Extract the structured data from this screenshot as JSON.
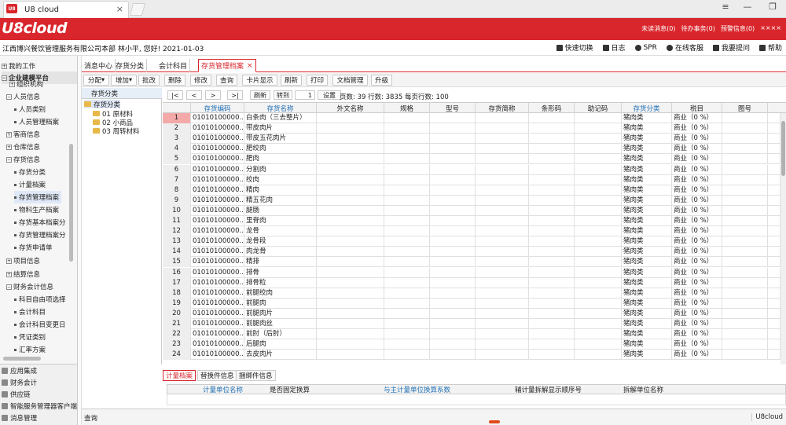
{
  "browser": {
    "tab_title": "U8 cloud",
    "tab_icon_text": "U8",
    "tab_close": "×",
    "win_menu": "≡",
    "win_min": "—",
    "win_restore": "❐"
  },
  "header": {
    "logo": "U8cloud",
    "links": [
      "未读消息(0)",
      "待办事务(0)",
      "预警信息(0)",
      "××××"
    ]
  },
  "infobar": {
    "company": "江西博兴餐饮管理服务有限公司本部 林小平, 您好! 2021-01-03",
    "links": [
      "快速切换",
      "日志",
      "SPR",
      "在线客服",
      "我要提问",
      "帮助"
    ]
  },
  "sidebar": {
    "my_work": "我的工作",
    "platform": "企业建模平台",
    "items": [
      "组织机构",
      "人员信息",
      "人员类别",
      "人员管理档案",
      "客商信息",
      "仓库信息",
      "存货信息",
      "存货分类",
      "计量档案",
      "存货管理档案",
      "物料生产档案",
      "存货基本档案分",
      "存货管理档案分",
      "存货申请单",
      "项目信息",
      "结算信息",
      "财务会计信息",
      "科目自由项选择",
      "会计科目",
      "会计科目变更日",
      "凭证类别",
      "汇率方案"
    ],
    "sections": [
      "应用集成",
      "财务会计",
      "供应链",
      "智能服务管理器客户端",
      "消息管理"
    ]
  },
  "content_tabs": [
    "消息中心",
    "存货分类",
    "会计科目",
    "存货管理档案",
    "×"
  ],
  "toolbar": [
    "分配",
    "增加",
    "批改",
    "删除",
    "修改",
    "查询",
    "卡片显示",
    "刷新",
    "打印",
    "文档管理",
    "升级"
  ],
  "tree": {
    "title": "存货分类",
    "root": "存货分类",
    "nodes": [
      "01 原材料",
      "02 小商品",
      "03 周转材料"
    ]
  },
  "pager": {
    "buttons": [
      "|<",
      "<",
      ">",
      ">|"
    ],
    "refresh": "刷新",
    "goto": "转到",
    "page": "1",
    "settings": "设置",
    "info": "页数: 39 行数: 3835 每页行数: 100"
  },
  "grid": {
    "columns": [
      "存货编码",
      "存货名称",
      "外文名称",
      "规格",
      "型号",
      "存货简称",
      "条形码",
      "助记码",
      "存货分类",
      "税目",
      "图号"
    ],
    "rows": [
      {
        "n": "1",
        "code": "01010100000...",
        "name": "白条肉（三去整片）",
        "cat": "猪肉类",
        "tax": "商业（0 %）"
      },
      {
        "n": "2",
        "code": "01010100000...",
        "name": "带皮肉片",
        "cat": "猪肉类",
        "tax": "商业（0 %）"
      },
      {
        "n": "3",
        "code": "01010100000...",
        "name": "带皮五花肉片",
        "cat": "猪肉类",
        "tax": "商业（0 %）"
      },
      {
        "n": "4",
        "code": "01010100000...",
        "name": "肥绞肉",
        "cat": "猪肉类",
        "tax": "商业（0 %）"
      },
      {
        "n": "5",
        "code": "01010100000...",
        "name": "肥肉",
        "cat": "猪肉类",
        "tax": "商业（0 %）"
      },
      {
        "n": "6",
        "code": "01010100000...",
        "name": "分割肉",
        "cat": "猪肉类",
        "tax": "商业（0 %）"
      },
      {
        "n": "7",
        "code": "01010100000...",
        "name": "绞肉",
        "cat": "猪肉类",
        "tax": "商业（0 %）"
      },
      {
        "n": "8",
        "code": "01010100000...",
        "name": "精肉",
        "cat": "猪肉类",
        "tax": "商业（0 %）"
      },
      {
        "n": "9",
        "code": "01010100000...",
        "name": "精五花肉",
        "cat": "猪肉类",
        "tax": "商业（0 %）"
      },
      {
        "n": "10",
        "code": "01010100000...",
        "name": "腿肠",
        "cat": "猪肉类",
        "tax": "商业（0 %）"
      },
      {
        "n": "11",
        "code": "01010100000...",
        "name": "里脊肉",
        "cat": "猪肉类",
        "tax": "商业（0 %）"
      },
      {
        "n": "12",
        "code": "01010100000...",
        "name": "龙骨",
        "cat": "猪肉类",
        "tax": "商业（0 %）"
      },
      {
        "n": "13",
        "code": "01010100000...",
        "name": "龙骨段",
        "cat": "猪肉类",
        "tax": "商业（0 %）"
      },
      {
        "n": "14",
        "code": "01010100000...",
        "name": "肉龙骨",
        "cat": "猪肉类",
        "tax": "商业（0 %）"
      },
      {
        "n": "15",
        "code": "01010100000...",
        "name": "精排",
        "cat": "猪肉类",
        "tax": "商业（0 %）"
      },
      {
        "n": "16",
        "code": "01010100000...",
        "name": "排骨",
        "cat": "猪肉类",
        "tax": "商业（0 %）"
      },
      {
        "n": "17",
        "code": "01010100000...",
        "name": "排骨粒",
        "cat": "猪肉类",
        "tax": "商业（0 %）"
      },
      {
        "n": "18",
        "code": "01010100000...",
        "name": "前腿绞肉",
        "cat": "猪肉类",
        "tax": "商业（0 %）"
      },
      {
        "n": "19",
        "code": "01010100000...",
        "name": "前腿肉",
        "cat": "猪肉类",
        "tax": "商业（0 %）"
      },
      {
        "n": "20",
        "code": "01010100000...",
        "name": "前腿肉片",
        "cat": "猪肉类",
        "tax": "商业（0 %）"
      },
      {
        "n": "21",
        "code": "01010100000...",
        "name": "前腿肉丝",
        "cat": "猪肉类",
        "tax": "商业（0 %）"
      },
      {
        "n": "22",
        "code": "01010100000...",
        "name": "前肘（后肘）",
        "cat": "猪肉类",
        "tax": "商业（0 %）"
      },
      {
        "n": "23",
        "code": "01010100000...",
        "name": "后腿肉",
        "cat": "猪肉类",
        "tax": "商业（0 %）"
      },
      {
        "n": "24",
        "code": "01010100000...",
        "name": "去皮肉片",
        "cat": "猪肉类",
        "tax": "商业（0 %）"
      }
    ]
  },
  "bottom_tabs": [
    "计量档案",
    "替换件信息",
    "捆绑件信息"
  ],
  "bottom_columns": [
    "计量单位名称",
    "是否固定换算",
    "与主计量单位换算系数",
    "辅计量拆解显示顺序号",
    "拆解单位名称"
  ],
  "status": {
    "left": "查询",
    "right": "U8cloud"
  }
}
